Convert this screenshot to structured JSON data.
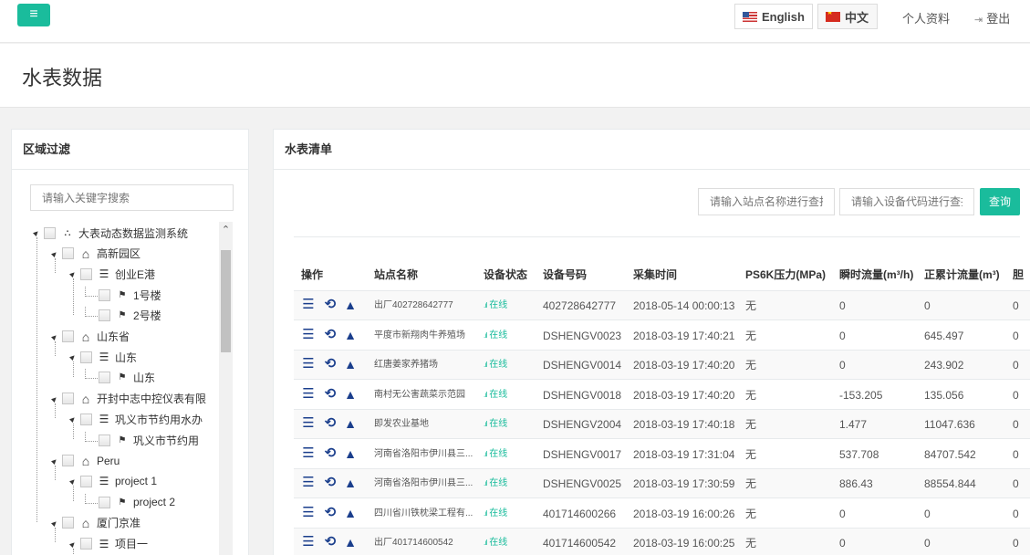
{
  "topbar": {
    "menu_icon": "≡",
    "lang_en": "English",
    "lang_zh": "中文",
    "profile": "个人资料",
    "logout": "登出"
  },
  "page": {
    "title": "水表数据"
  },
  "filter": {
    "title": "区域过滤",
    "search_placeholder": "请输入关键字搜索",
    "tree": [
      {
        "level": 0,
        "label": "大表动态数据监测系统",
        "icon": "sitemap-icon",
        "expanded": true
      },
      {
        "level": 1,
        "label": "高新园区",
        "icon": "home-icon",
        "expanded": true
      },
      {
        "level": 2,
        "label": "创业E港",
        "icon": "list-icon",
        "expanded": true
      },
      {
        "level": 3,
        "label": "1号楼",
        "icon": "flag-icon"
      },
      {
        "level": 3,
        "label": "2号楼",
        "icon": "flag-icon"
      },
      {
        "level": 1,
        "label": "山东省",
        "icon": "home-icon",
        "expanded": true
      },
      {
        "level": 2,
        "label": "山东",
        "icon": "list-icon",
        "expanded": true
      },
      {
        "level": 3,
        "label": "山东",
        "icon": "flag-icon"
      },
      {
        "level": 1,
        "label": "开封中志中控仪表有限",
        "icon": "home-icon",
        "expanded": true
      },
      {
        "level": 2,
        "label": "巩义市节约用水办",
        "icon": "list-icon",
        "expanded": true
      },
      {
        "level": 3,
        "label": "巩义市节约用",
        "icon": "flag-icon"
      },
      {
        "level": 1,
        "label": "Peru",
        "icon": "home-icon",
        "expanded": true
      },
      {
        "level": 2,
        "label": "project 1",
        "icon": "list-icon",
        "expanded": true
      },
      {
        "level": 3,
        "label": "project 2",
        "icon": "flag-icon"
      },
      {
        "level": 1,
        "label": "厦门京准",
        "icon": "home-icon",
        "expanded": true
      },
      {
        "level": 2,
        "label": "项目一",
        "icon": "list-icon",
        "expanded": true
      }
    ]
  },
  "meters": {
    "title": "水表清单",
    "site_placeholder": "请输入站点名称进行查找",
    "code_placeholder": "请输入设备代码进行查找",
    "query_label": "查询",
    "columns": [
      "操作",
      "站点名称",
      "设备状态",
      "设备号码",
      "采集时间",
      "PS6K压力(MPa)",
      "瞬时流量(m³/h)",
      "正累计流量(m³)",
      "胆"
    ],
    "rows": [
      {
        "site": "出厂402728642777",
        "status": "在线",
        "device": "402728642777",
        "time": "2018-05-14 00:00:13",
        "pressure": "无",
        "flow": "0",
        "total": "0",
        "last": "0"
      },
      {
        "site": "平度市新翔肉牛养殖场",
        "status": "在线",
        "device": "DSHENGV0023",
        "time": "2018-03-19 17:40:21",
        "pressure": "无",
        "flow": "0",
        "total": "645.497",
        "last": "0"
      },
      {
        "site": "红唐姜家养猪场",
        "status": "在线",
        "device": "DSHENGV0014",
        "time": "2018-03-19 17:40:20",
        "pressure": "无",
        "flow": "0",
        "total": "243.902",
        "last": "0"
      },
      {
        "site": "南村无公害蔬菜示范园",
        "status": "在线",
        "device": "DSHENGV0018",
        "time": "2018-03-19 17:40:20",
        "pressure": "无",
        "flow": "-153.205",
        "total": "135.056",
        "last": "0"
      },
      {
        "site": "即发农业基地",
        "status": "在线",
        "device": "DSHENGV2004",
        "time": "2018-03-19 17:40:18",
        "pressure": "无",
        "flow": "1.477",
        "total": "11047.636",
        "last": "0"
      },
      {
        "site": "河南省洛阳市伊川县三...",
        "status": "在线",
        "device": "DSHENGV0017",
        "time": "2018-03-19 17:31:04",
        "pressure": "无",
        "flow": "537.708",
        "total": "84707.542",
        "last": "0"
      },
      {
        "site": "河南省洛阳市伊川县三...",
        "status": "在线",
        "device": "DSHENGV0025",
        "time": "2018-03-19 17:30:59",
        "pressure": "无",
        "flow": "886.43",
        "total": "88554.844",
        "last": "0"
      },
      {
        "site": "四川省川铁枕梁工程有...",
        "status": "在线",
        "device": "401714600266",
        "time": "2018-03-19 16:00:26",
        "pressure": "无",
        "flow": "0",
        "total": "0",
        "last": "0"
      },
      {
        "site": "出厂401714600542",
        "status": "在线",
        "device": "401714600542",
        "time": "2018-03-19 16:00:25",
        "pressure": "无",
        "flow": "0",
        "total": "0",
        "last": "0"
      }
    ]
  },
  "colors": {
    "accent": "#1abc9c",
    "action_icon": "#1a3e8c"
  }
}
